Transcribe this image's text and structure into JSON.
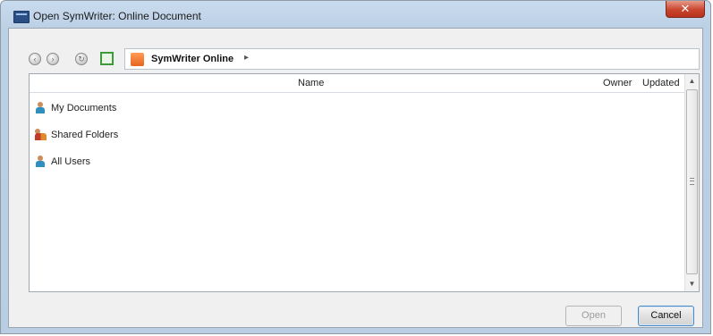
{
  "window": {
    "title": "Open SymWriter: Online Document",
    "close_icon": "close-icon",
    "close_label": "✕"
  },
  "toolbar": {
    "back_icon": "back-arrow-icon",
    "forward_icon": "forward-arrow-icon",
    "refresh_icon": "refresh-icon",
    "home_icon": "home-icon",
    "address": {
      "icon": "symwriter-online-icon",
      "label": "SymWriter Online",
      "arrow": "▸"
    }
  },
  "list": {
    "columns": {
      "name": "Name",
      "owner": "Owner",
      "updated": "Updated"
    },
    "items": [
      {
        "label": "My Documents",
        "icon": "user-icon"
      },
      {
        "label": "Shared Folders",
        "icon": "shared-users-icon"
      },
      {
        "label": "All Users",
        "icon": "user-icon"
      }
    ],
    "scroll_up": "▲",
    "scroll_down": "▼"
  },
  "buttons": {
    "open_label": "Open",
    "cancel_label": "Cancel"
  },
  "colors": {
    "title_bar": "#bcd0e6",
    "close_button": "#c9452e",
    "client_bg": "#f0f0f0",
    "home_green": "#3f9b3a",
    "address_icon_orange": "#e8641f"
  }
}
